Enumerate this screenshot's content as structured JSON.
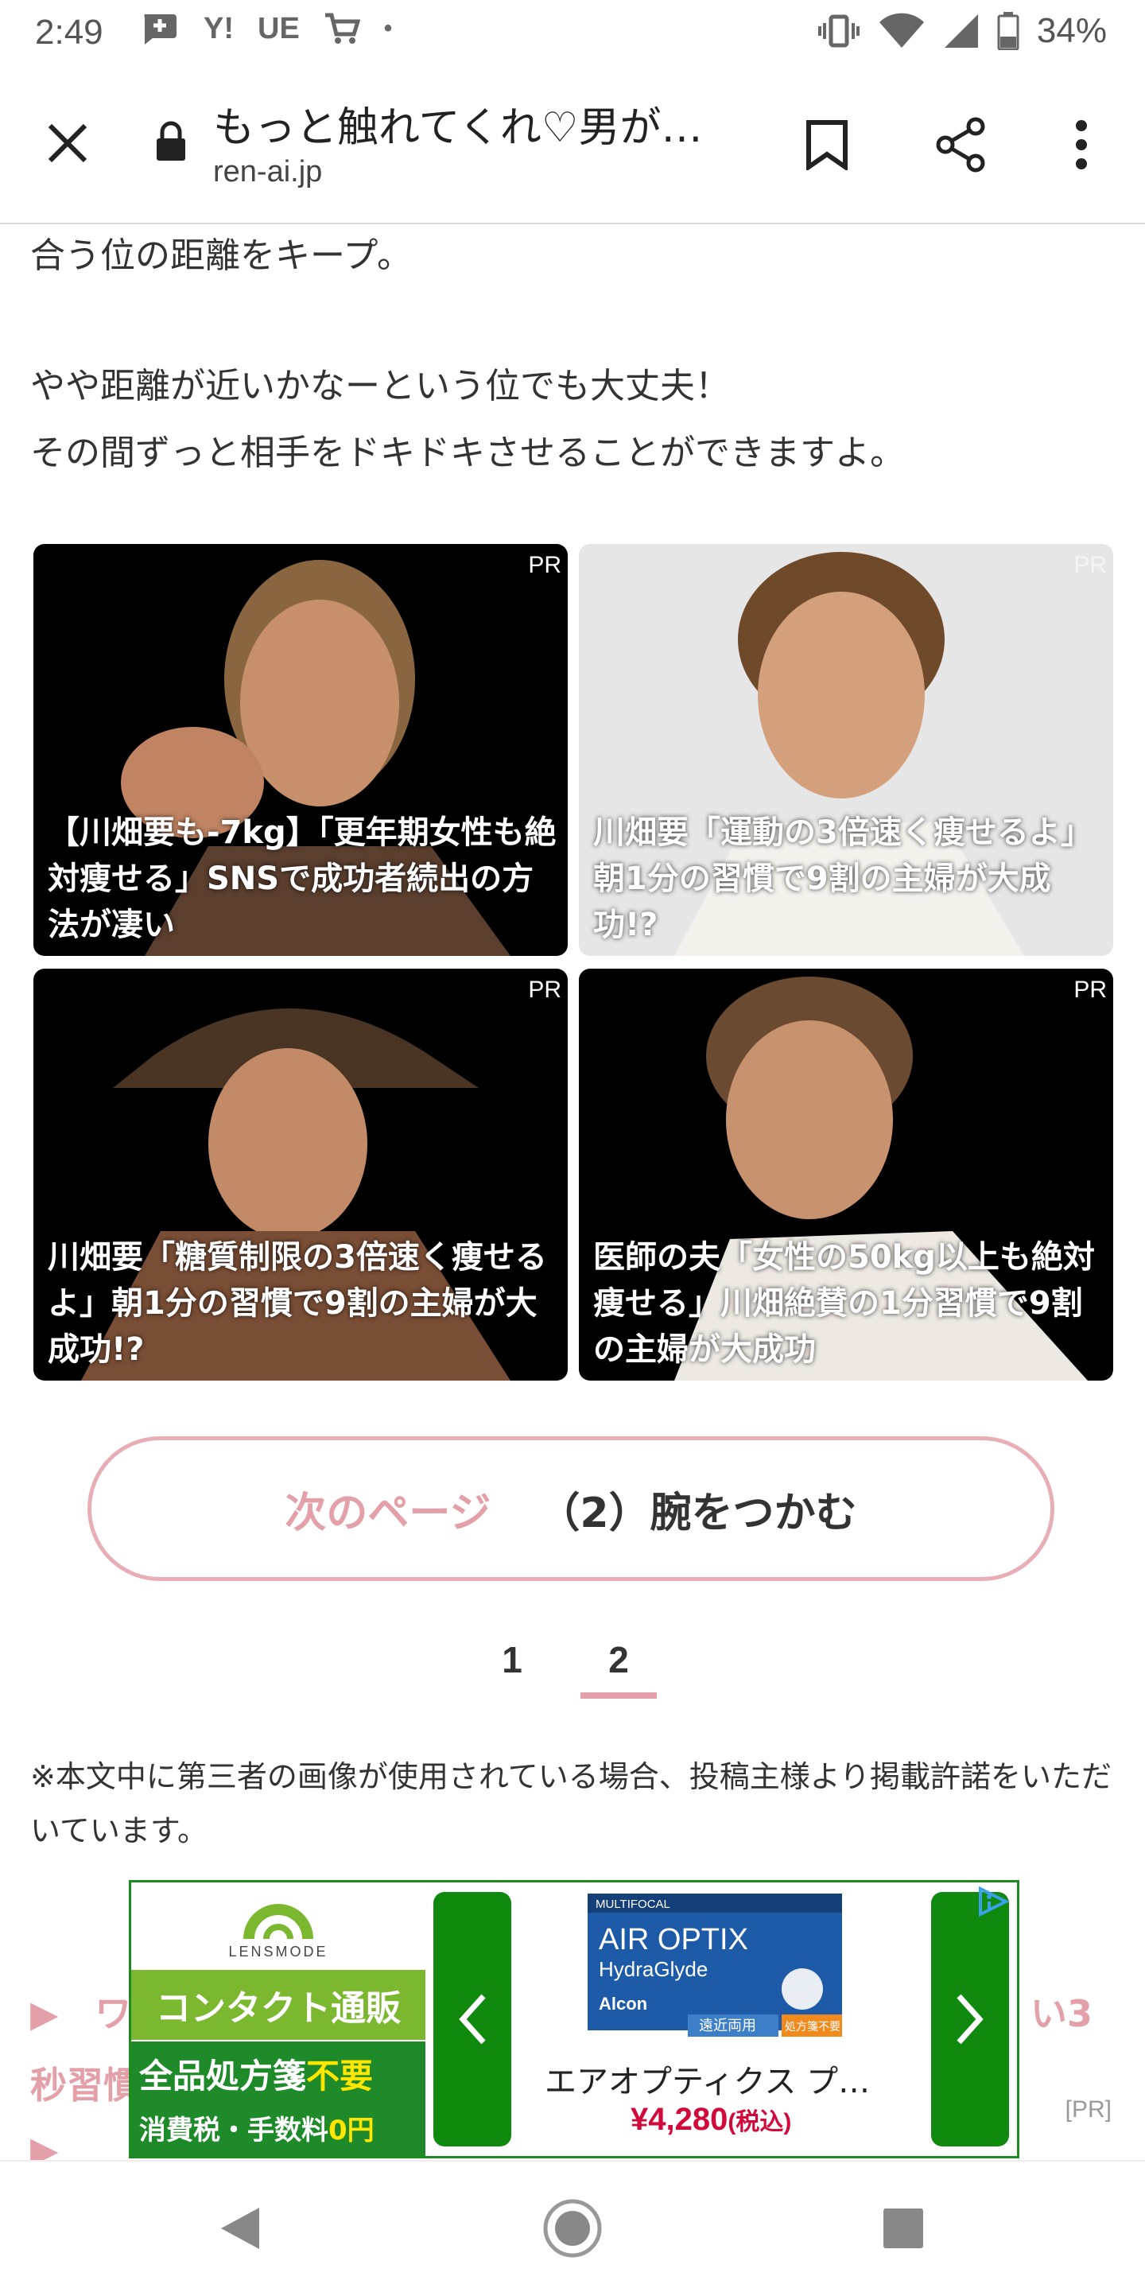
{
  "status_bar": {
    "time": "2:49",
    "left_icons": [
      "chat-add-icon",
      "Y!",
      "UE",
      "cart-icon",
      "•"
    ],
    "battery": "34%"
  },
  "toolbar": {
    "title": "もっと触れてくれ♡男が…",
    "domain": "ren-ai.jp",
    "close_icon": "close-icon",
    "bookmark_icon": "bookmark-icon",
    "share_icon": "share-icon",
    "menu_icon": "more-vert-icon"
  },
  "article": {
    "line1": "合う位の距離をキープ。",
    "line2": "やや距離が近いかなーという位でも大丈夫！",
    "line3": "その間ずっと相手をドキドキさせることができますよ。"
  },
  "ads": [
    {
      "pr": "PR",
      "caption": "【川畑要も-7kg】「更年期女性も絶対痩せる」SNSで成功者続出の方法が凄い",
      "bg": "#000000"
    },
    {
      "pr": "PR",
      "caption": "川畑要「運動の3倍速く痩せるよ」朝1分の習慣で9割の主婦が大成功!?",
      "bg": "#e9e9e9"
    },
    {
      "pr": "PR",
      "caption": "川畑要「糖質制限の3倍速く痩せるよ」朝1分の習慣で9割の主婦が大成功!?",
      "bg": "#000000"
    },
    {
      "pr": "PR",
      "caption": "医師の夫「女性の50kg以上も絶対痩せる」川畑絶賛の1分習慣で9割の主婦が大成功",
      "bg": "#000000"
    }
  ],
  "next_page": {
    "label": "次のページ",
    "title": "（2）腕をつかむ"
  },
  "pager": {
    "pages": [
      "1",
      "2"
    ],
    "current": "2"
  },
  "note": "※本文中に第三者の画像が使用されている場合、投稿主様より掲載許諾をいただいています。",
  "behind_links": {
    "left1": "▶　ワ",
    "left2": "秒習慣",
    "right1": "い3",
    "left3": "▶"
  },
  "bottom_ad": {
    "brand": "LENSMODE",
    "banner1": "コンタクト通販",
    "banner2_a": "全品処方箋",
    "banner2_a_highlight": "不要",
    "banner2_b": "消費税・手数料",
    "banner2_b_highlight": "0円",
    "product_box": {
      "tag": "MULTIFOCAL",
      "name": "AIR OPTIX",
      "sub": "HydraGlyde",
      "maker": "Alcon",
      "label1": "遠近両用",
      "label2": "処方箋不要"
    },
    "product_name": "エアオプティクス プ…",
    "price": "¥4,280",
    "price_tax": "(税込)",
    "pr_label": "[PR]"
  },
  "nav": {
    "back": "back-icon",
    "home": "home-icon",
    "recents": "recents-icon"
  },
  "colors": {
    "accent_pink": "#e3a0a8",
    "ad_green": "#1e8a2a",
    "price_red": "#d20a3c"
  }
}
